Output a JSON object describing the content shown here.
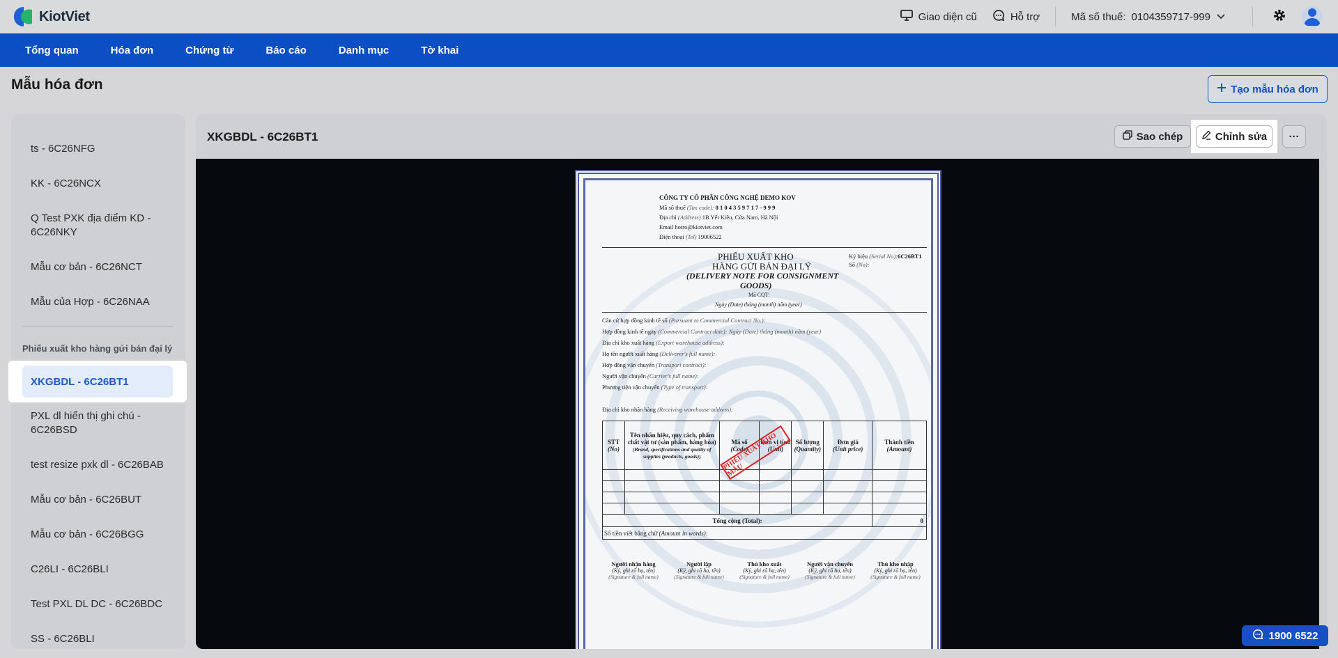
{
  "brand": {
    "name": "KiotViet"
  },
  "topbar": {
    "old_ui_label": "Giao diện cũ",
    "help_label": "Hỗ trợ",
    "tax_label": "Mã số thuế:",
    "tax_value": "0104359717-999"
  },
  "nav": [
    "Tổng quan",
    "Hóa đơn",
    "Chứng từ",
    "Báo cáo",
    "Danh mục",
    "Tờ khai"
  ],
  "page": {
    "title": "Mẫu hóa đơn",
    "create_label": "Tạo mẫu hóa đơn"
  },
  "sidebar": {
    "items_top": [
      "ts - 6C26NFG",
      "KK - 6C26NCX",
      "Q Test PXK địa điểm KD - 6C26NKY",
      "Mẫu cơ bản - 6C26NCT",
      "Mẫu của Hợp - 6C26NAA"
    ],
    "group_label": "Phiếu xuất kho hàng gửi bán đại lý",
    "active_item": "XKGBDL - 6C26BT1",
    "items_bottom": [
      "PXL dl hiển thị ghi chú - 6C26BSD",
      "test resize pxk dl - 6C26BAB",
      "Mẫu cơ bản - 6C26BUT",
      "Mẫu cơ bản - 6C26BGG",
      "C26LI - 6C26BLI",
      "Test PXL DL DC - 6C26BDC",
      "SS - 6C26BLI"
    ]
  },
  "detail": {
    "title": "XKGBDL - 6C26BT1",
    "copy_label": "Sao chép",
    "edit_label": "Chỉnh sửa",
    "more_label": "···"
  },
  "document": {
    "company": "CÔNG TY CỔ PHẦN CÔNG NGHỆ DEMO KOV",
    "tax_line_label": "Mã số thuế",
    "tax_line_en": "(Tax code):",
    "tax_line_value": "0 1 0 4 3 5 9 7 1 7 - 9 9 9",
    "address_label": "Địa chỉ",
    "address_en": "(Address)",
    "address_value": "1B Yết Kiêu, Cửa Nam, Hà Nội",
    "email_line": "Email hotro@kiotviet.com",
    "phone_label": "Điện thoại",
    "phone_en": "(Tel)",
    "phone_value": "19006522",
    "title1": "PHIẾU XUẤT KHO",
    "title2": "HÀNG GỬI BÁN ĐẠI LÝ",
    "title_en1": "(DELIVERY NOTE FOR CONSIGNMENT",
    "title_en2": "GOODS)",
    "cqt": "Mã CQT:",
    "date_line": "Ngày (Date) tháng (month) năm (year)",
    "serial_label": "Ký hiệu",
    "serial_en": "(Serial No):",
    "serial_value": "6C26BT1",
    "no_label": "Số",
    "no_en": "(No):",
    "fields": [
      [
        "Căn cứ hợp đồng kinh tế số",
        "(Pursuant to Commercial Contract No.):"
      ],
      [
        "Hợp đồng kinh tế ngày",
        "(Commercial Contract date):  Ngày (Date)  tháng (month)  năm (year)"
      ],
      [
        "Địa chỉ kho xuất hàng",
        "(Export warehouse address):"
      ],
      [
        "Họ tên người xuất hàng",
        "(Deliverer's full name):"
      ],
      [
        "Hợp đồng vận chuyển",
        "(Transport contract):"
      ],
      [
        "Người vận chuyển",
        "(Carrier's full name):"
      ],
      [
        "Phương tiện vận chuyển",
        "(Type of transport):"
      ]
    ],
    "receiving": [
      "Địa chỉ kho nhận hàng",
      "(Receiving warehouse address):"
    ],
    "columns": [
      [
        "STT",
        "(No)"
      ],
      [
        "Tên nhãn hiệu, quy cách, phẩm chất vật tư (sản phẩm, hàng hóa)",
        "(Brand, specifications and quality of supplies (products, goods))"
      ],
      [
        "Mã số",
        "(Code)"
      ],
      [
        "Đơn vị tính",
        "(Unit)"
      ],
      [
        "Số lượng",
        "(Quantity)"
      ],
      [
        "Đơn giá",
        "(Unit price)"
      ],
      [
        "Thành tiền",
        "(Amount)"
      ]
    ],
    "total_label": "Tổng cộng (Total):",
    "total_value": "0",
    "words_label": "Số tiền viết bằng chữ",
    "words_en": "(Amount in words):",
    "stamp": "PHIẾU XUẤT KHO MẪU",
    "signers": [
      [
        "Người nhận hàng",
        "(Ký, ghi rõ họ, tên)",
        "(Signature & full name)"
      ],
      [
        "Người lập",
        "(Ký, ghi rõ họ, tên)",
        "(Signature & full name)"
      ],
      [
        "Thủ kho xuất",
        "(Ký, ghi rõ họ, tên)",
        "(Signature & full name)"
      ],
      [
        "Người vận chuyển",
        "(Ký, ghi rõ họ, tên)",
        "(Signature & full name)"
      ],
      [
        "Thủ kho nhập",
        "(Ký, ghi rõ họ, tên)",
        "(Signature & full name)"
      ]
    ]
  },
  "support": {
    "phone": "1900 6522"
  },
  "colors": {
    "primary": "#0c4fc4",
    "active_bg": "#e3ecfb",
    "stamp": "#d22222"
  }
}
